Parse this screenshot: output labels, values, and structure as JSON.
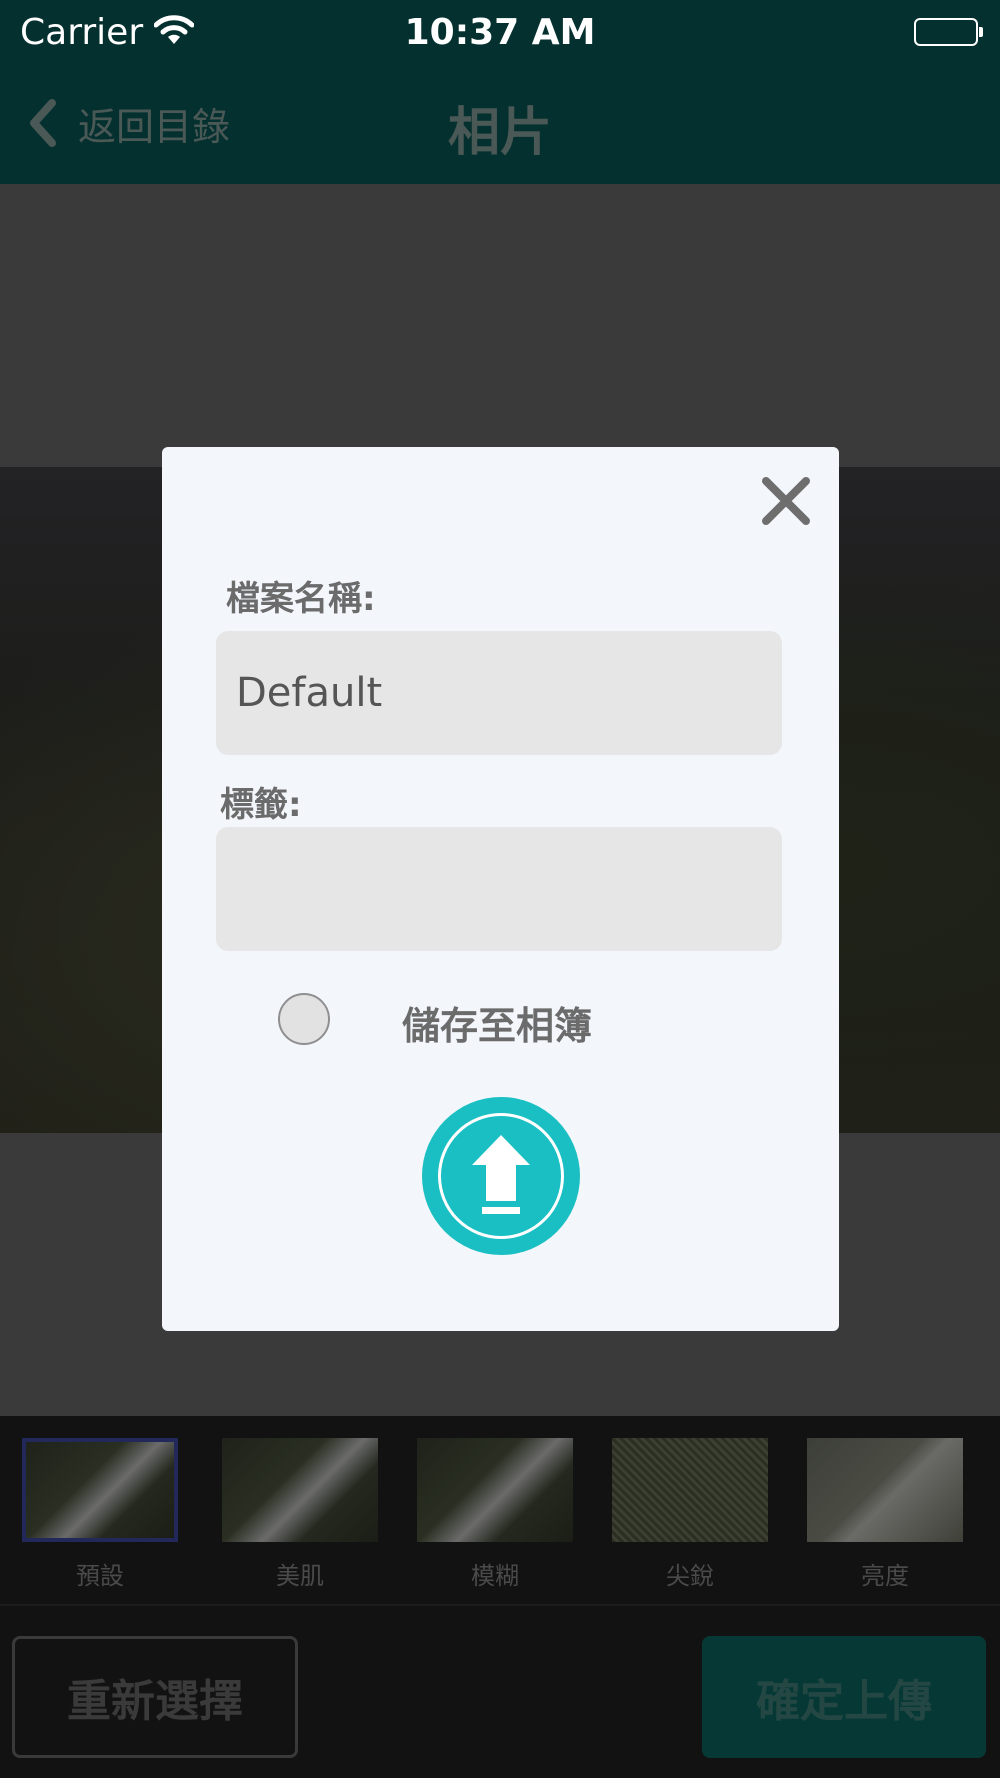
{
  "status_bar": {
    "carrier": "Carrier",
    "time": "10:37 AM"
  },
  "nav": {
    "back_label": "返回目錄",
    "title": "相片"
  },
  "filters": [
    {
      "label": "預設",
      "selected": true
    },
    {
      "label": "美肌",
      "selected": false
    },
    {
      "label": "模糊",
      "selected": false
    },
    {
      "label": "尖銳",
      "selected": false
    },
    {
      "label": "亮度",
      "selected": false
    }
  ],
  "bottom_bar": {
    "reselect_label": "重新選擇",
    "confirm_label": "確定上傳"
  },
  "modal": {
    "filename_label": "檔案名稱:",
    "filename_value": "Default",
    "tags_label": "標籤:",
    "tags_value": "",
    "save_to_album_label": "儲存至相簿",
    "save_to_album_checked": false
  },
  "colors": {
    "nav_bg": "#04312f",
    "accent": "#19bfc2",
    "modal_bg": "#f3f7fc",
    "input_bg": "#e6e6e6"
  },
  "icons": {
    "back": "chevron-left-icon",
    "close": "close-icon",
    "upload": "upload-arrow-icon",
    "wifi": "wifi-icon",
    "battery": "battery-icon"
  }
}
